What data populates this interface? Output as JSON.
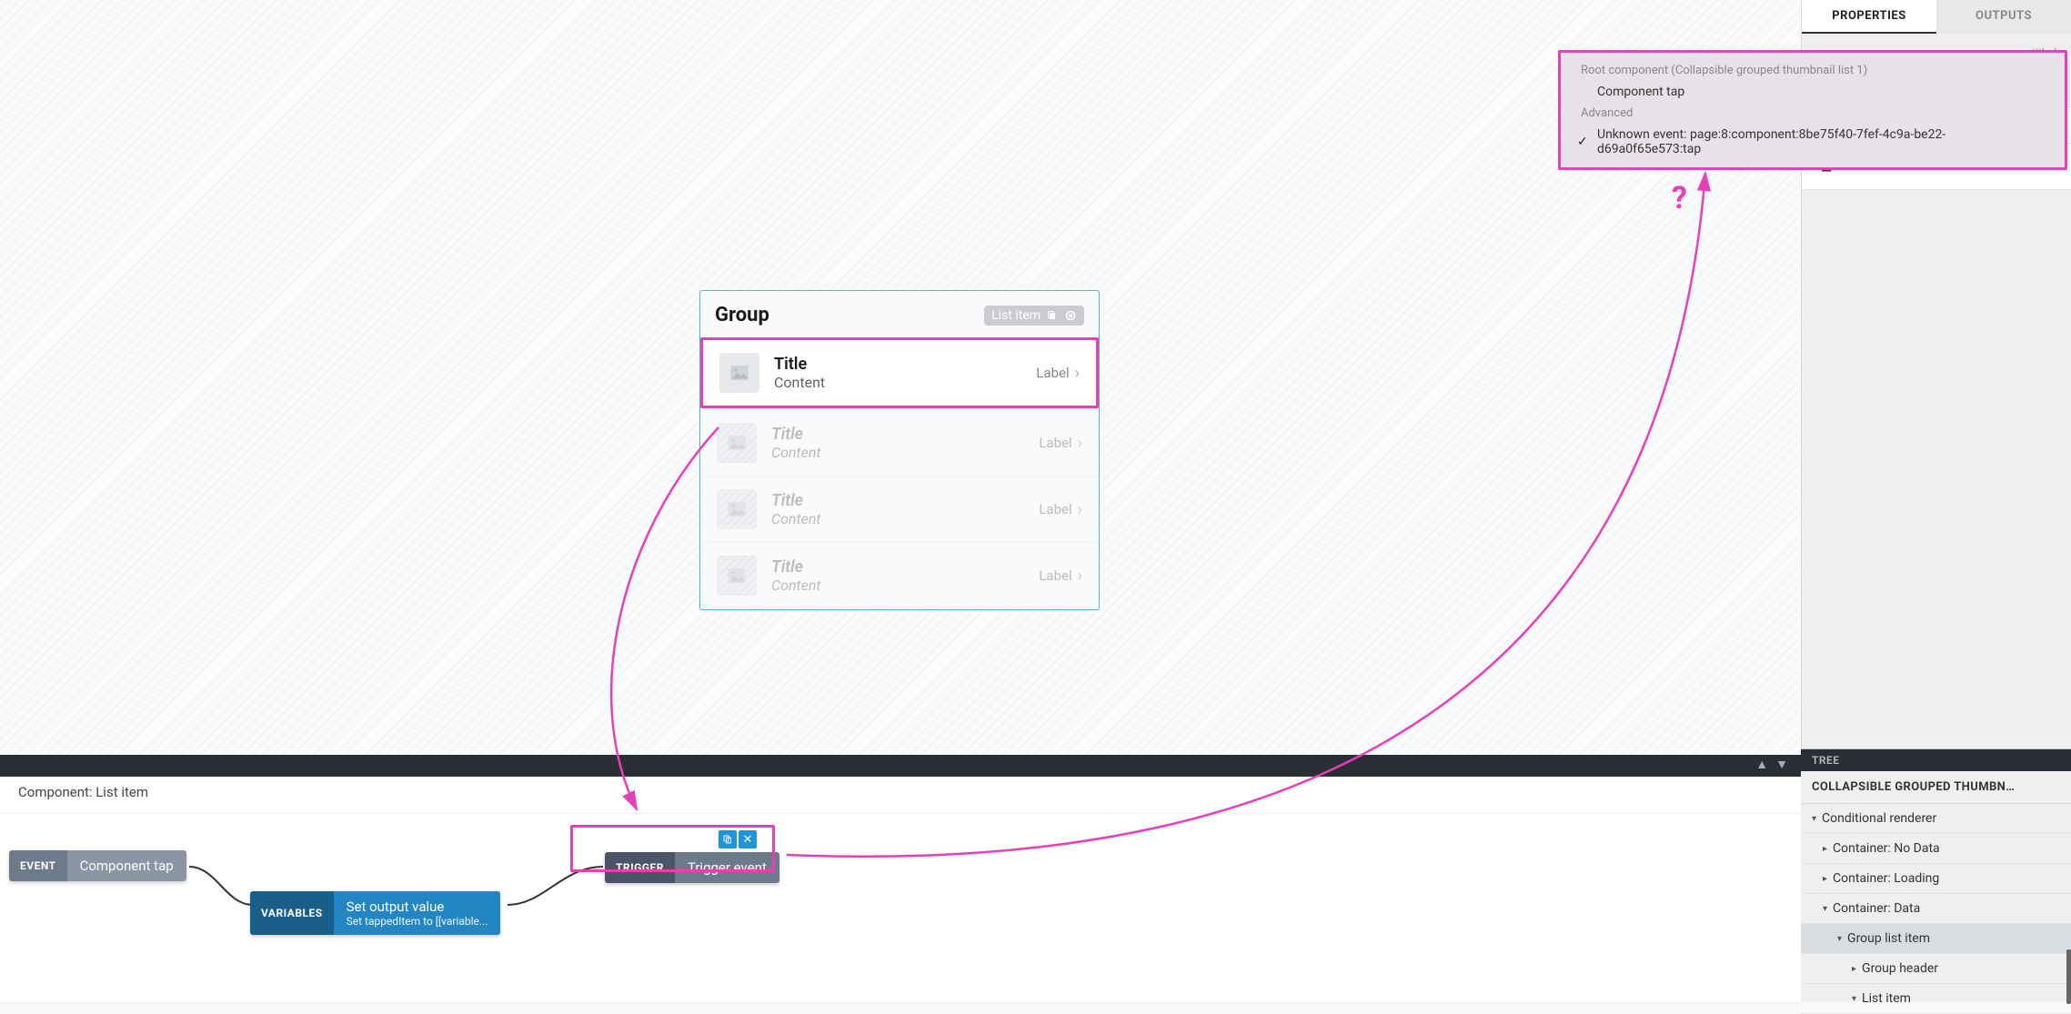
{
  "canvas": {
    "group_title": "Group",
    "group_badge_label": "List item",
    "items": [
      {
        "title": "Title",
        "content": "Content",
        "label": "Label"
      },
      {
        "title": "Title",
        "content": "Content",
        "label": "Label"
      },
      {
        "title": "Title",
        "content": "Content",
        "label": "Label"
      },
      {
        "title": "Title",
        "content": "Content",
        "label": "Label"
      }
    ]
  },
  "flow": {
    "header": "Component: List item",
    "event_tag": "EVENT",
    "event_label": "Component tap",
    "variables_tag": "VARIABLES",
    "variables_label": "Set output value",
    "variables_sub": "Set tappedItem to [[variable...",
    "trigger_tag": "TRIGGER",
    "trigger_label": "Trigger event"
  },
  "sidebar": {
    "tab_properties": "PROPERTIES",
    "tab_outputs": "OUTPUTS",
    "untitled": "untitled",
    "advanced": "ADVANCED"
  },
  "tree": {
    "header": "TREE",
    "title": "COLLAPSIBLE GROUPED THUMBN…",
    "items": [
      {
        "level": 0,
        "label": "Conditional renderer",
        "open": true
      },
      {
        "level": 1,
        "label": "Container: No Data",
        "open": false
      },
      {
        "level": 1,
        "label": "Container: Loading",
        "open": false
      },
      {
        "level": 1,
        "label": "Container: Data",
        "open": true
      },
      {
        "level": 2,
        "label": "Group list item",
        "open": true,
        "selected": true
      },
      {
        "level": 3,
        "label": "Group header",
        "open": false
      },
      {
        "level": 3,
        "label": "List item",
        "open": true
      }
    ]
  },
  "dropdown": {
    "group1": "Root component (Collapsible grouped thumbnail list 1)",
    "item1": "Component tap",
    "group2": "Advanced",
    "item2": "Unknown event: page:8:component:8be75f40-7fef-4c9a-be22-d69a0f65e573:tap"
  },
  "annotation": {
    "question": "?"
  }
}
